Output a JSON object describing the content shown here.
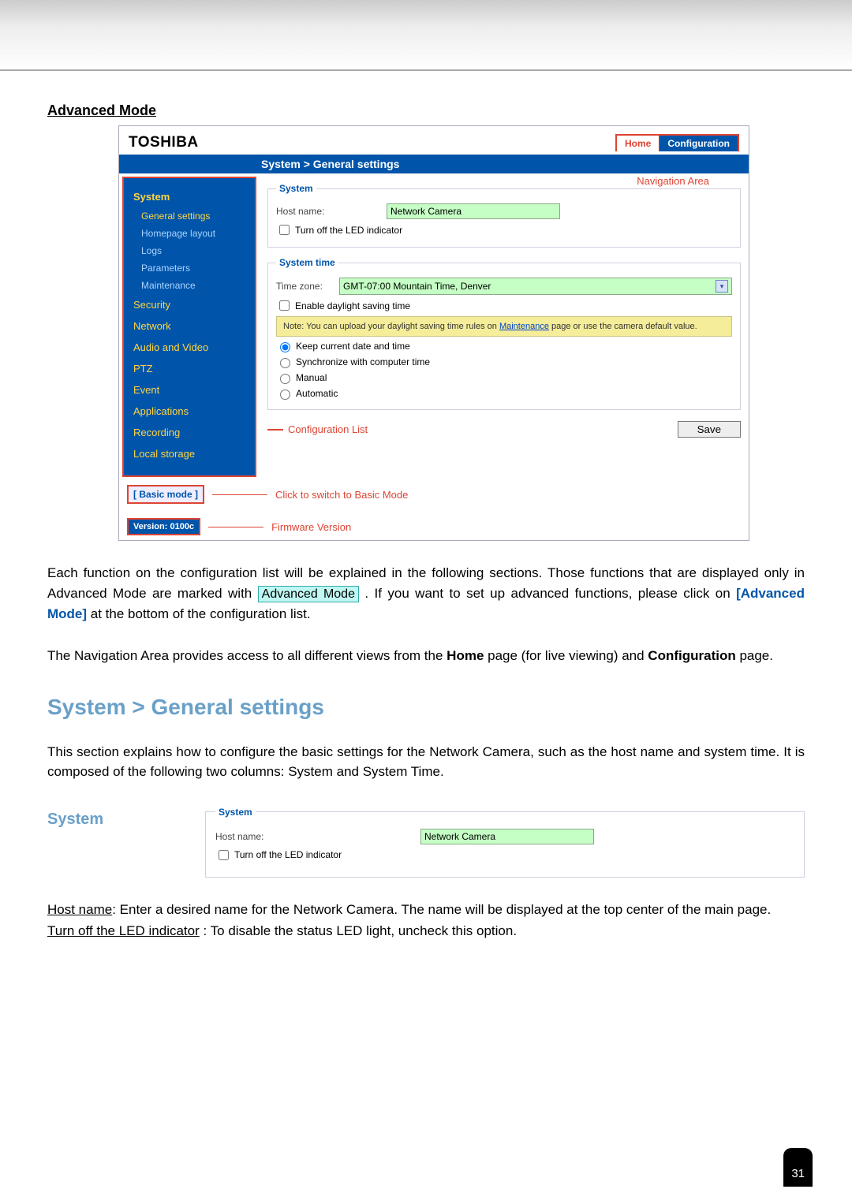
{
  "doc": {
    "advanced_hdr": "Advanced Mode",
    "page_number": "31"
  },
  "ss": {
    "brand": "TOSHIBA",
    "tabs": {
      "home": "Home",
      "conf": "Configuration"
    },
    "breadcrumb": "System  >  General settings",
    "nav_area_label": "Navigation Area",
    "sidebar": {
      "main": [
        "System"
      ],
      "subs": [
        "General settings",
        "Homepage layout",
        "Logs",
        "Parameters",
        "Maintenance"
      ],
      "rest": [
        "Security",
        "Network",
        "Audio and Video",
        "PTZ",
        "Event",
        "Applications",
        "Recording",
        "Local storage"
      ]
    },
    "system": {
      "legend": "System",
      "host_label": "Host name:",
      "host_value": "Network Camera",
      "led_label": "Turn off the LED indicator"
    },
    "systime": {
      "legend": "System time",
      "tz_label": "Time zone:",
      "tz_value": "GMT-07:00 Mountain Time, Denver",
      "dst_label": "Enable daylight saving time",
      "note_pre": "Note: You can upload your daylight saving time rules on ",
      "note_link": "Maintenance",
      "note_post": " page or use the camera default value.",
      "r1": "Keep current date and time",
      "r2": "Synchronize with computer time",
      "r3": "Manual",
      "r4": "Automatic"
    },
    "cfg_label": "Configuration List",
    "save_label": "Save",
    "basic_btn": "[ Basic mode ]",
    "basic_ann": "Click to switch to Basic Mode",
    "ver_val": "Version: 0100c",
    "ver_ann": "Firmware Version"
  },
  "body": {
    "p1a": "Each function on the configuration list will be explained in the following sections. Those functions that are displayed only in Advanced Mode are marked with ",
    "tag": "Advanced Mode",
    "p1b": ". If you want to set up advanced functions, please click on ",
    "link1": "[Advanced Mode]",
    "p1c": " at the bottom of the configuration list.",
    "p2a": "The Navigation Area provides access to all different views from the ",
    "b1": "Home",
    "p2b": " page (for live viewing) and ",
    "b2": "Configuration",
    "p2c": " page.",
    "h2": "System > General settings",
    "p3": "This section explains how to configure the basic settings for the Network Camera, such as the host name and system time. It is composed of the following two columns: System and System Time.",
    "h3": "System",
    "ss2": {
      "legend": "System",
      "host_label": "Host name:",
      "host_value": "Network Camera",
      "led": "Turn off the LED indicator"
    },
    "p4_u1": "Host name",
    "p4a": ": Enter a desired name for the Network Camera. The name will be displayed at the top center of the main page.",
    "p5_u1": "Turn off the LED indicator",
    "p5a": " : To disable the status LED light, uncheck this option."
  }
}
